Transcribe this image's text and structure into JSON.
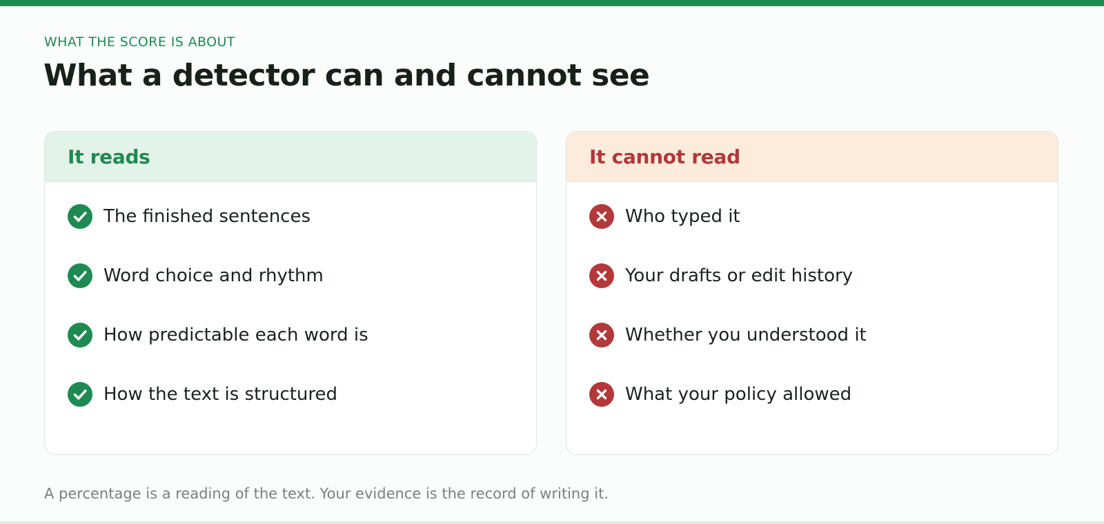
{
  "eyebrow": "WHAT THE SCORE IS ABOUT",
  "title": "What a detector can and cannot see",
  "colors": {
    "accent_green": "#1e8a52",
    "accent_red": "#b2383a",
    "reads_header_bg": "#e2f3e9",
    "cannot_header_bg": "#fdebdb"
  },
  "reads_card": {
    "heading": "It reads",
    "icon": "check-circle-icon",
    "items": [
      {
        "label": "The finished sentences"
      },
      {
        "label": "Word choice and rhythm"
      },
      {
        "label": "How predictable each word is"
      },
      {
        "label": "How the text is structured"
      }
    ]
  },
  "cannot_card": {
    "heading": "It cannot read",
    "icon": "x-circle-icon",
    "items": [
      {
        "label": "Who typed it"
      },
      {
        "label": "Your drafts or edit history"
      },
      {
        "label": "Whether you understood it"
      },
      {
        "label": "What your policy allowed"
      }
    ]
  },
  "footnote": "A percentage is a reading of the text. Your evidence is the record of writing it."
}
